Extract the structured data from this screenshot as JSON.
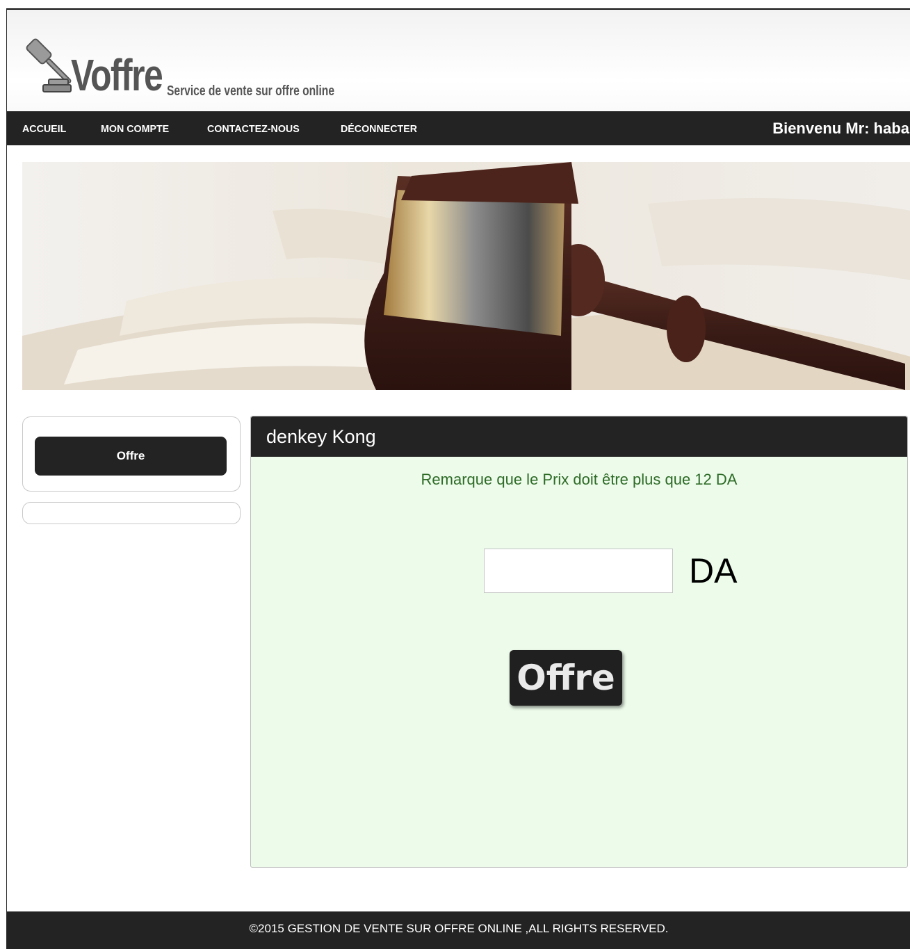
{
  "header": {
    "brand": "Voffre",
    "tagline": "Service de vente sur offre online"
  },
  "nav": {
    "items": [
      {
        "label": "ACCUEIL"
      },
      {
        "label": "MON COMPTE"
      },
      {
        "label": "CONTACTEZ-NOUS"
      },
      {
        "label": "DÉCONNECTER"
      }
    ],
    "welcome": "Bienvenu Mr: haba"
  },
  "sidebar": {
    "offer_button": "Offre"
  },
  "panel": {
    "title": "denkey Kong",
    "notice": "Remarque que le Prix doit être plus que 12 DA",
    "price_input": {
      "value": "",
      "placeholder": ""
    },
    "currency": "DA",
    "submit_label": "Offre"
  },
  "footer": {
    "text": "©2015 GESTION DE VENTE SUR OFFRE ONLINE ,ALL RIGHTS RESERVED."
  },
  "colors": {
    "dark_bar": "#232323",
    "panel_bg": "#ecfbea",
    "notice_text": "#2e6b27"
  },
  "icons": {
    "logo": "gavel-icon"
  }
}
